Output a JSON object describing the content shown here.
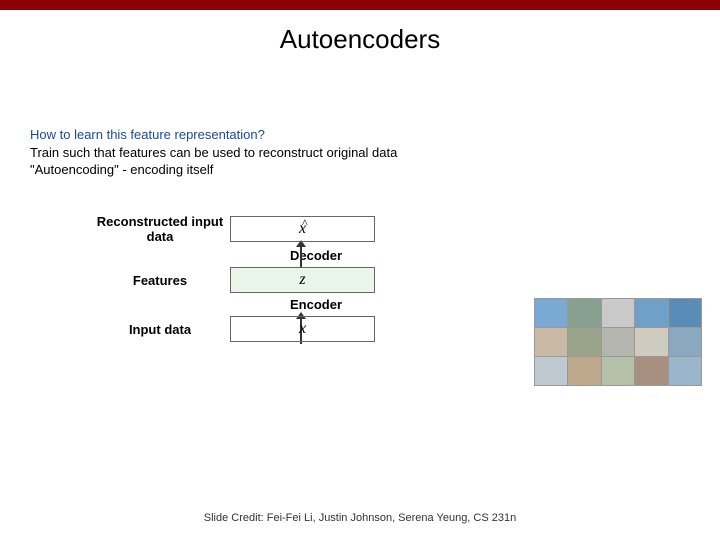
{
  "title": "Autoencoders",
  "body": {
    "question": "How to learn this feature representation?",
    "line1": "Train such that features can be used to reconstruct original data",
    "line2": "\"Autoencoding\" - encoding itself"
  },
  "diagram": {
    "reconstructed_label": "Reconstructed input data",
    "reconstructed_symbol": "x̂",
    "decoder_label": "Decoder",
    "features_label": "Features",
    "features_symbol": "z",
    "encoder_label": "Encoder",
    "input_label": "Input data",
    "input_symbol": "x"
  },
  "grid_colors": [
    "#7aa9d4",
    "#88a090",
    "#c9c9c9",
    "#6ea0c8",
    "#5a8cb8",
    "#c9b9a5",
    "#9aa48a",
    "#b5b5b0",
    "#d0cbc0",
    "#8aa8c0",
    "#c0c8d0",
    "#bda88c",
    "#b5c0a8",
    "#a89080",
    "#9ab5cc"
  ],
  "credit": "Slide Credit: Fei-Fei Li, Justin Johnson, Serena Yeung, CS 231n"
}
